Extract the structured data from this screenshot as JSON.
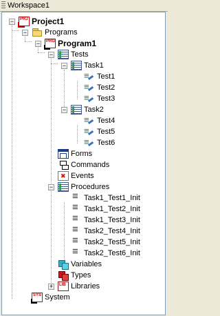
{
  "window": {
    "title": "Workspace1"
  },
  "tree": {
    "project": {
      "label": "Project1",
      "icon": "project-icon"
    },
    "programs": {
      "label": "Programs",
      "icon": "folder-icon"
    },
    "program": {
      "label": "Program1",
      "icon": "program-icon"
    },
    "tests": {
      "label": "Tests",
      "icon": "tests-list-icon"
    },
    "task1": {
      "label": "Task1",
      "icon": "task-icon",
      "items": [
        "Test1",
        "Test2",
        "Test3"
      ]
    },
    "task2": {
      "label": "Task2",
      "icon": "task-icon",
      "items": [
        "Test4",
        "Test5",
        "Test6"
      ]
    },
    "forms": {
      "label": "Forms",
      "icon": "form-icon"
    },
    "commands": {
      "label": "Commands",
      "icon": "commands-icon"
    },
    "events": {
      "label": "Events",
      "icon": "events-icon"
    },
    "procedures": {
      "label": "Procedures",
      "icon": "procedures-icon",
      "items": [
        "Task1_Test1_Init",
        "Task1_Test2_Init",
        "Task1_Test3_Init",
        "Task2_Test4_Init",
        "Task2_Test5_Init",
        "Task2_Test6_Init"
      ]
    },
    "variables": {
      "label": "Variables",
      "icon": "variables-icon"
    },
    "types": {
      "label": "Types",
      "icon": "types-icon"
    },
    "libraries": {
      "label": "Libraries",
      "icon": "libraries-icon"
    },
    "system": {
      "label": "System",
      "icon": "system-icon"
    }
  },
  "expander": {
    "expanded": "−",
    "collapsed": "+"
  }
}
